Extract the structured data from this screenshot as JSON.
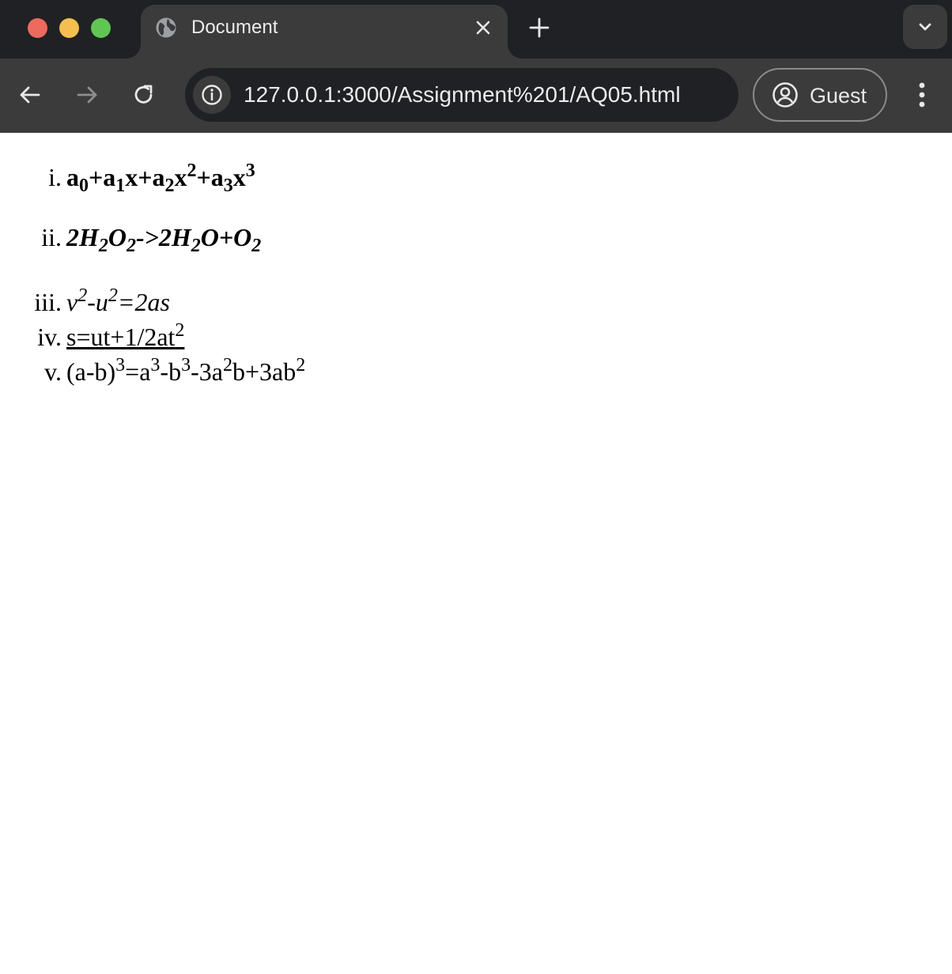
{
  "browser": {
    "tab_title": "Document",
    "url": "127.0.0.1:3000/Assignment%201/AQ05.html",
    "profile_label": "Guest"
  },
  "list": {
    "items": [
      {
        "marker": "i.",
        "style": "bold",
        "parts": [
          {
            "t": "a"
          },
          {
            "sub": "0"
          },
          {
            "t": "+a"
          },
          {
            "sub": "1"
          },
          {
            "t": "x+a"
          },
          {
            "sub": "2"
          },
          {
            "t": "x"
          },
          {
            "sup": "2"
          },
          {
            "t": "+a"
          },
          {
            "sub": "3"
          },
          {
            "t": "x"
          },
          {
            "sup": "3"
          }
        ]
      },
      {
        "marker": "ii.",
        "style": "bold-italic",
        "parts": [
          {
            "t": "2H"
          },
          {
            "sub": "2"
          },
          {
            "t": "O"
          },
          {
            "sub": "2"
          },
          {
            "t": "->2H"
          },
          {
            "sub": "2"
          },
          {
            "t": "O+O"
          },
          {
            "sub": "2"
          }
        ]
      },
      {
        "marker": "iii.",
        "style": "italic",
        "parts": [
          {
            "t": "v"
          },
          {
            "sup": "2"
          },
          {
            "t": "-u"
          },
          {
            "sup": "2"
          },
          {
            "t": "=2as"
          }
        ]
      },
      {
        "marker": "iv.",
        "style": "underline",
        "parts": [
          {
            "t": "s=ut+1/2at"
          },
          {
            "sup": "2"
          }
        ]
      },
      {
        "marker": "v.",
        "style": "normal",
        "parts": [
          {
            "t": "(a-b)"
          },
          {
            "sup": "3"
          },
          {
            "t": "=a"
          },
          {
            "sup": "3"
          },
          {
            "t": "-b"
          },
          {
            "sup": "3"
          },
          {
            "t": "-3a"
          },
          {
            "sup": "2"
          },
          {
            "t": "b+3ab"
          },
          {
            "sup": "2"
          }
        ]
      }
    ]
  }
}
